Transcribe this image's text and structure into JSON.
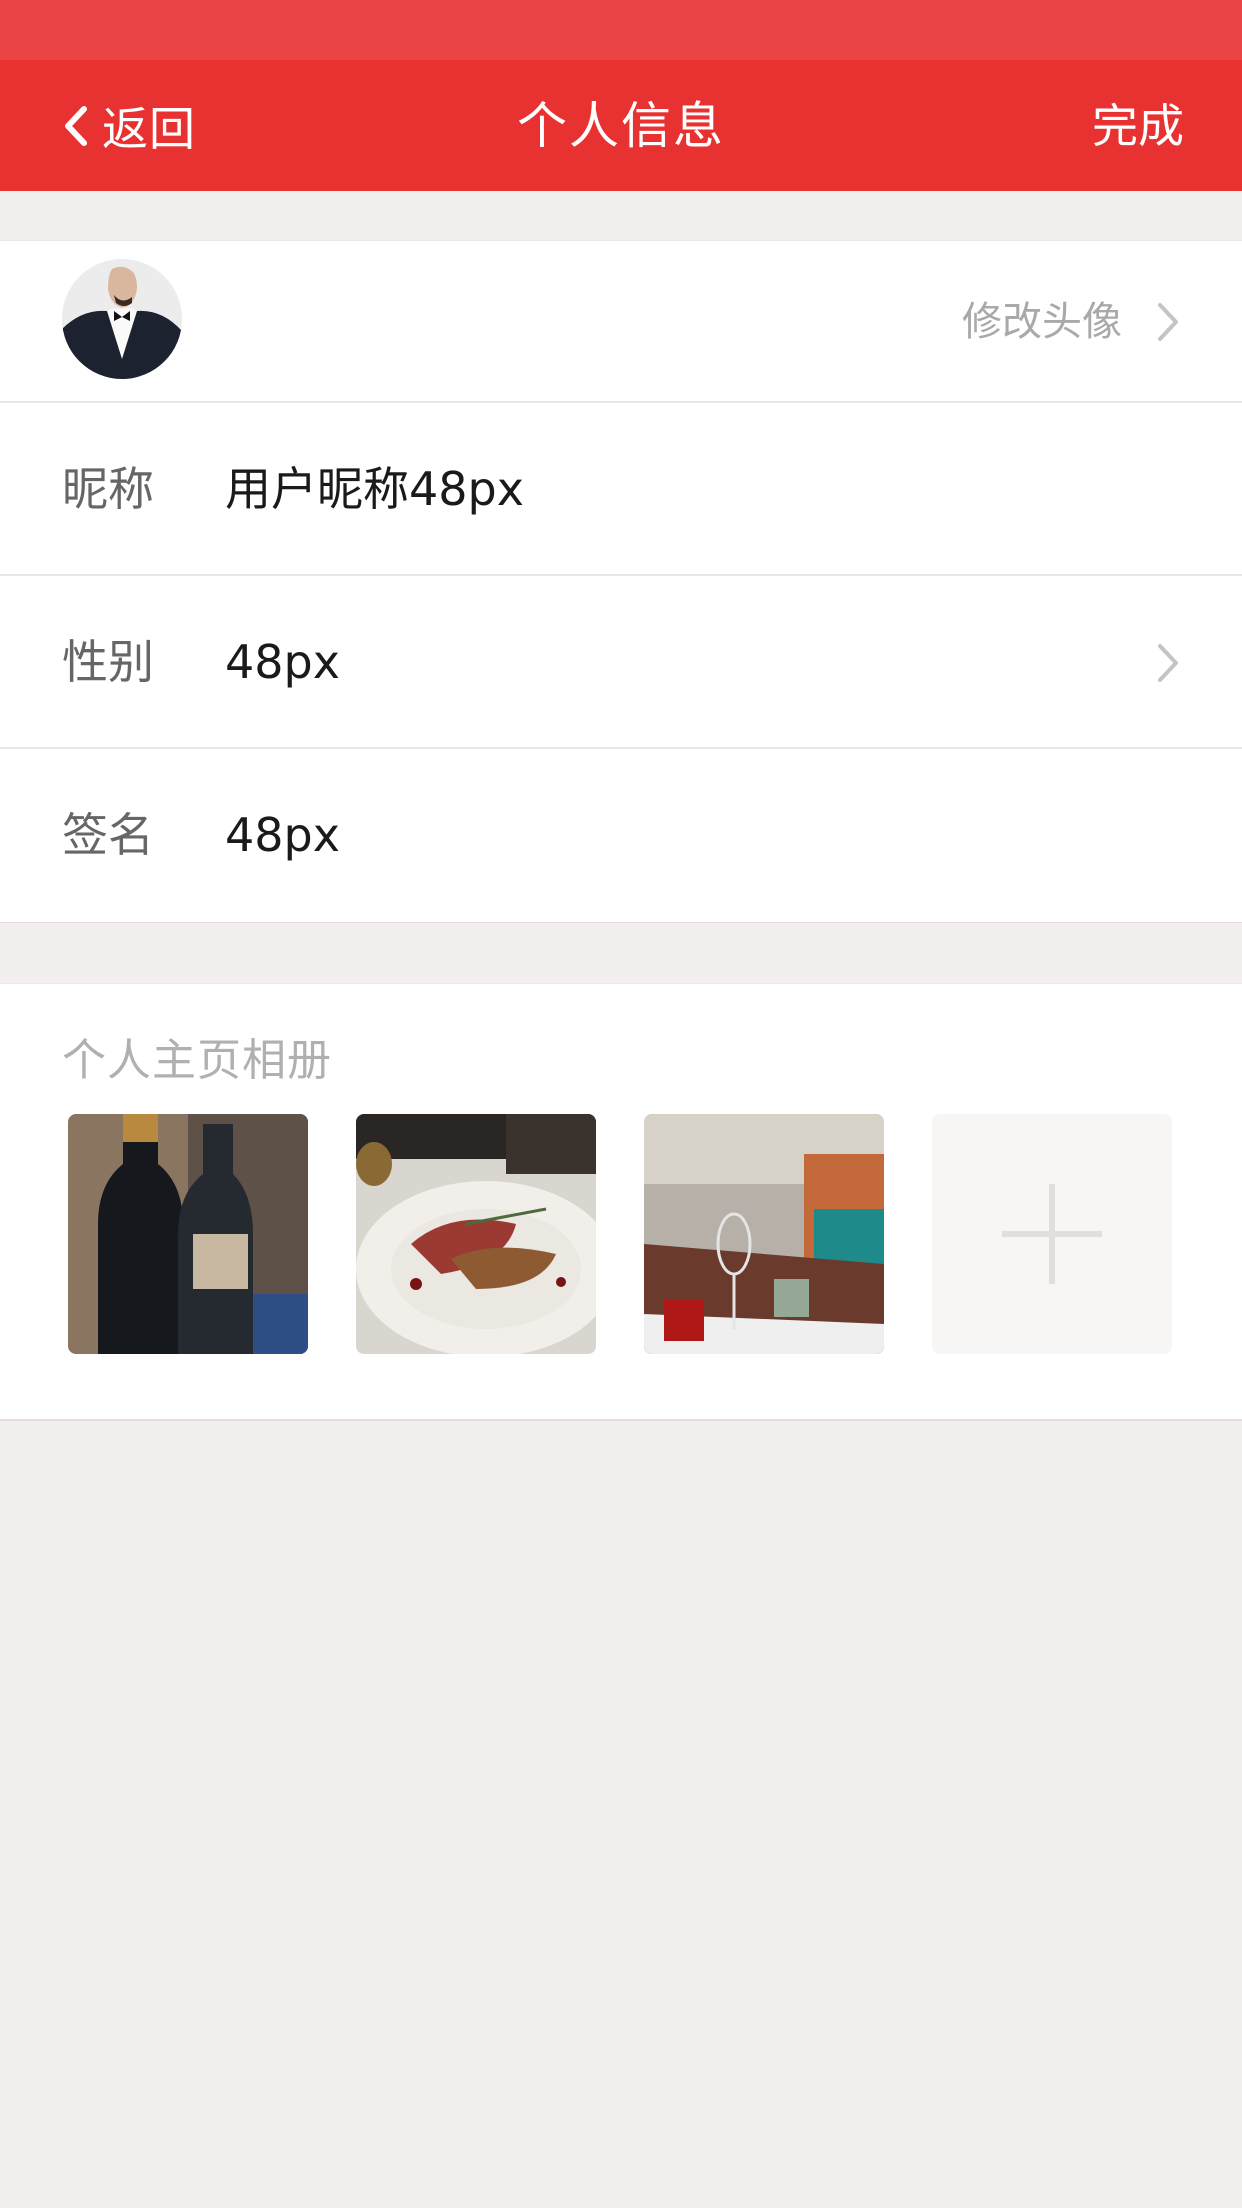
{
  "nav": {
    "back_label": "返回",
    "title": "个人信息",
    "done_label": "完成"
  },
  "profile": {
    "avatar_action": "修改头像",
    "fields": [
      {
        "label": "昵称",
        "value": "用户昵称48px"
      },
      {
        "label": "性别",
        "value": "48px"
      },
      {
        "label": "签名",
        "value": "48px"
      }
    ]
  },
  "album": {
    "title": "个人主页相册",
    "photos": [
      "wine-bottle-photo",
      "steak-dish-photo",
      "restaurant-table-photo"
    ],
    "add_icon": "plus-icon"
  },
  "colors": {
    "nav_background": "#e83232",
    "page_background": "#f4efef"
  }
}
